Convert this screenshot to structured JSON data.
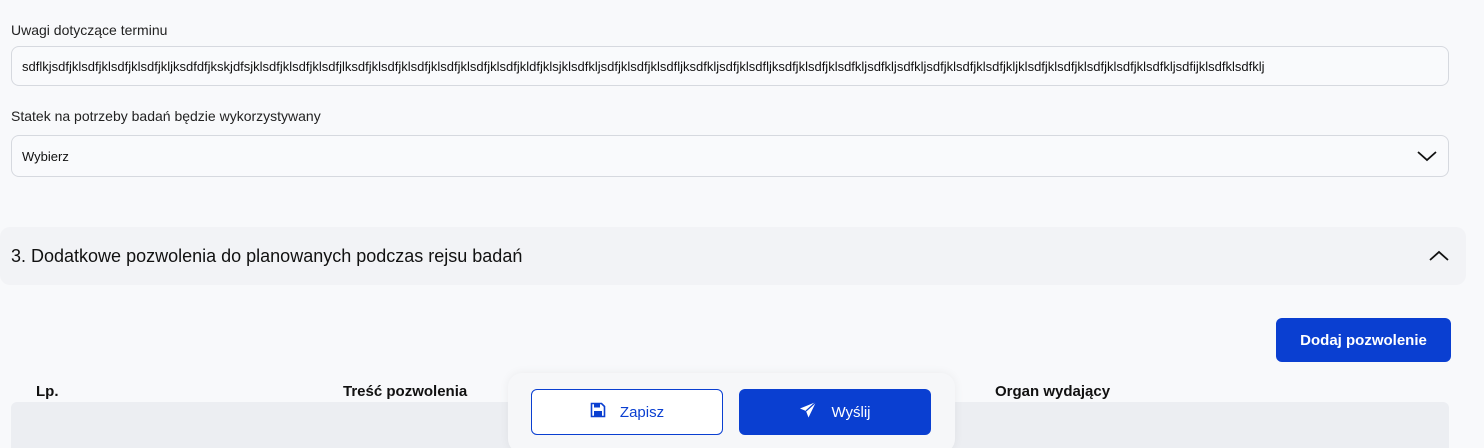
{
  "fields": {
    "notes_label": "Uwagi dotyczące terminu",
    "notes_value": "sdflkjsdfjklsdfjklsdfjklsdfjkljksdfdfjkskjdfsjklsdfjklsdfjklsdfjlksdfjklsdfjklsdfjklsdfjklsdfjklsdfjkldfjklsjklsdfkljsdfjklsdfjklsdfljksdfkljsdfjklsdfljksdfjklsdfjklsdfkljsdfkljsdfkljsdfjklsdfjklsdfjkljklsdfjklsdfjklsdfjklsdfjklsdfkljsdfijklsdfklsdfklj",
    "ship_label": "Statek na potrzeby badań będzie wykorzystywany",
    "ship_value": "Wybierz"
  },
  "section": {
    "title": "3. Dodatkowe pozwolenia do planowanych podczas rejsu badań"
  },
  "permissions": {
    "add_button": "Dodaj pozwolenie",
    "columns": [
      "Lp.",
      "Treść pozwolenia",
      "Organ wydający"
    ]
  },
  "actions": {
    "save": "Zapisz",
    "send": "Wyślij"
  },
  "colors": {
    "primary": "#0a3fd1"
  },
  "icons": {
    "select": "chevron-down-icon",
    "section": "chevron-up-icon",
    "save": "floppy-disk-icon",
    "send": "paper-plane-icon"
  }
}
